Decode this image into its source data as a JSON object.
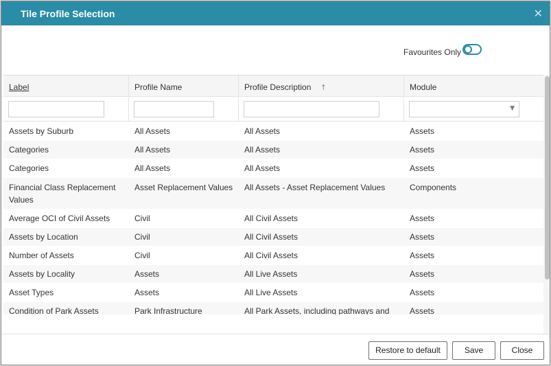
{
  "dialog": {
    "title": "Tile Profile Selection",
    "close_glyph": "✕"
  },
  "favourites": {
    "label": "Favourites Only",
    "enabled": false
  },
  "table": {
    "columns": [
      {
        "label": "Label",
        "sorted": false
      },
      {
        "label": "Profile Name",
        "sorted": false
      },
      {
        "label": "Profile Description",
        "sorted": true,
        "sort_icon": "↑"
      },
      {
        "label": "Module",
        "sorted": false
      }
    ],
    "rows": [
      {
        "label": "Assets by Suburb",
        "profile_name": "All Assets",
        "description": "All Assets",
        "module": "Assets"
      },
      {
        "label": "Categories",
        "profile_name": "All Assets",
        "description": "All Assets",
        "module": "Assets"
      },
      {
        "label": "Categories",
        "profile_name": "All Assets",
        "description": "All Assets",
        "module": "Assets"
      },
      {
        "label": "Financial Class Replacement Values",
        "profile_name": "Asset Replacement Values",
        "description": "All Assets - Asset Replacement Values",
        "module": "Components"
      },
      {
        "label": "Average OCI of Civil Assets",
        "profile_name": "Civil",
        "description": "All Civil Assets",
        "module": "Assets"
      },
      {
        "label": "Assets by Location",
        "profile_name": "Civil",
        "description": "All Civil Assets",
        "module": "Assets"
      },
      {
        "label": "Number of Assets",
        "profile_name": "Civil",
        "description": "All Civil Assets",
        "module": "Assets"
      },
      {
        "label": "Assets by Locality",
        "profile_name": "Assets",
        "description": "All Live Assets",
        "module": "Assets"
      },
      {
        "label": "Asset Types",
        "profile_name": "Assets",
        "description": "All Live Assets",
        "module": "Assets"
      },
      {
        "label": "Condition of Park Assets",
        "profile_name": "Park Infrastructure",
        "description": "All Park Assets, including pathways and",
        "module": "Assets"
      }
    ]
  },
  "footer": {
    "restore_label": "Restore to default",
    "save_label": "Save",
    "close_label": "Close"
  },
  "colors": {
    "titlebar": "#2a8ca6",
    "toggle": "#2a8ca6"
  }
}
